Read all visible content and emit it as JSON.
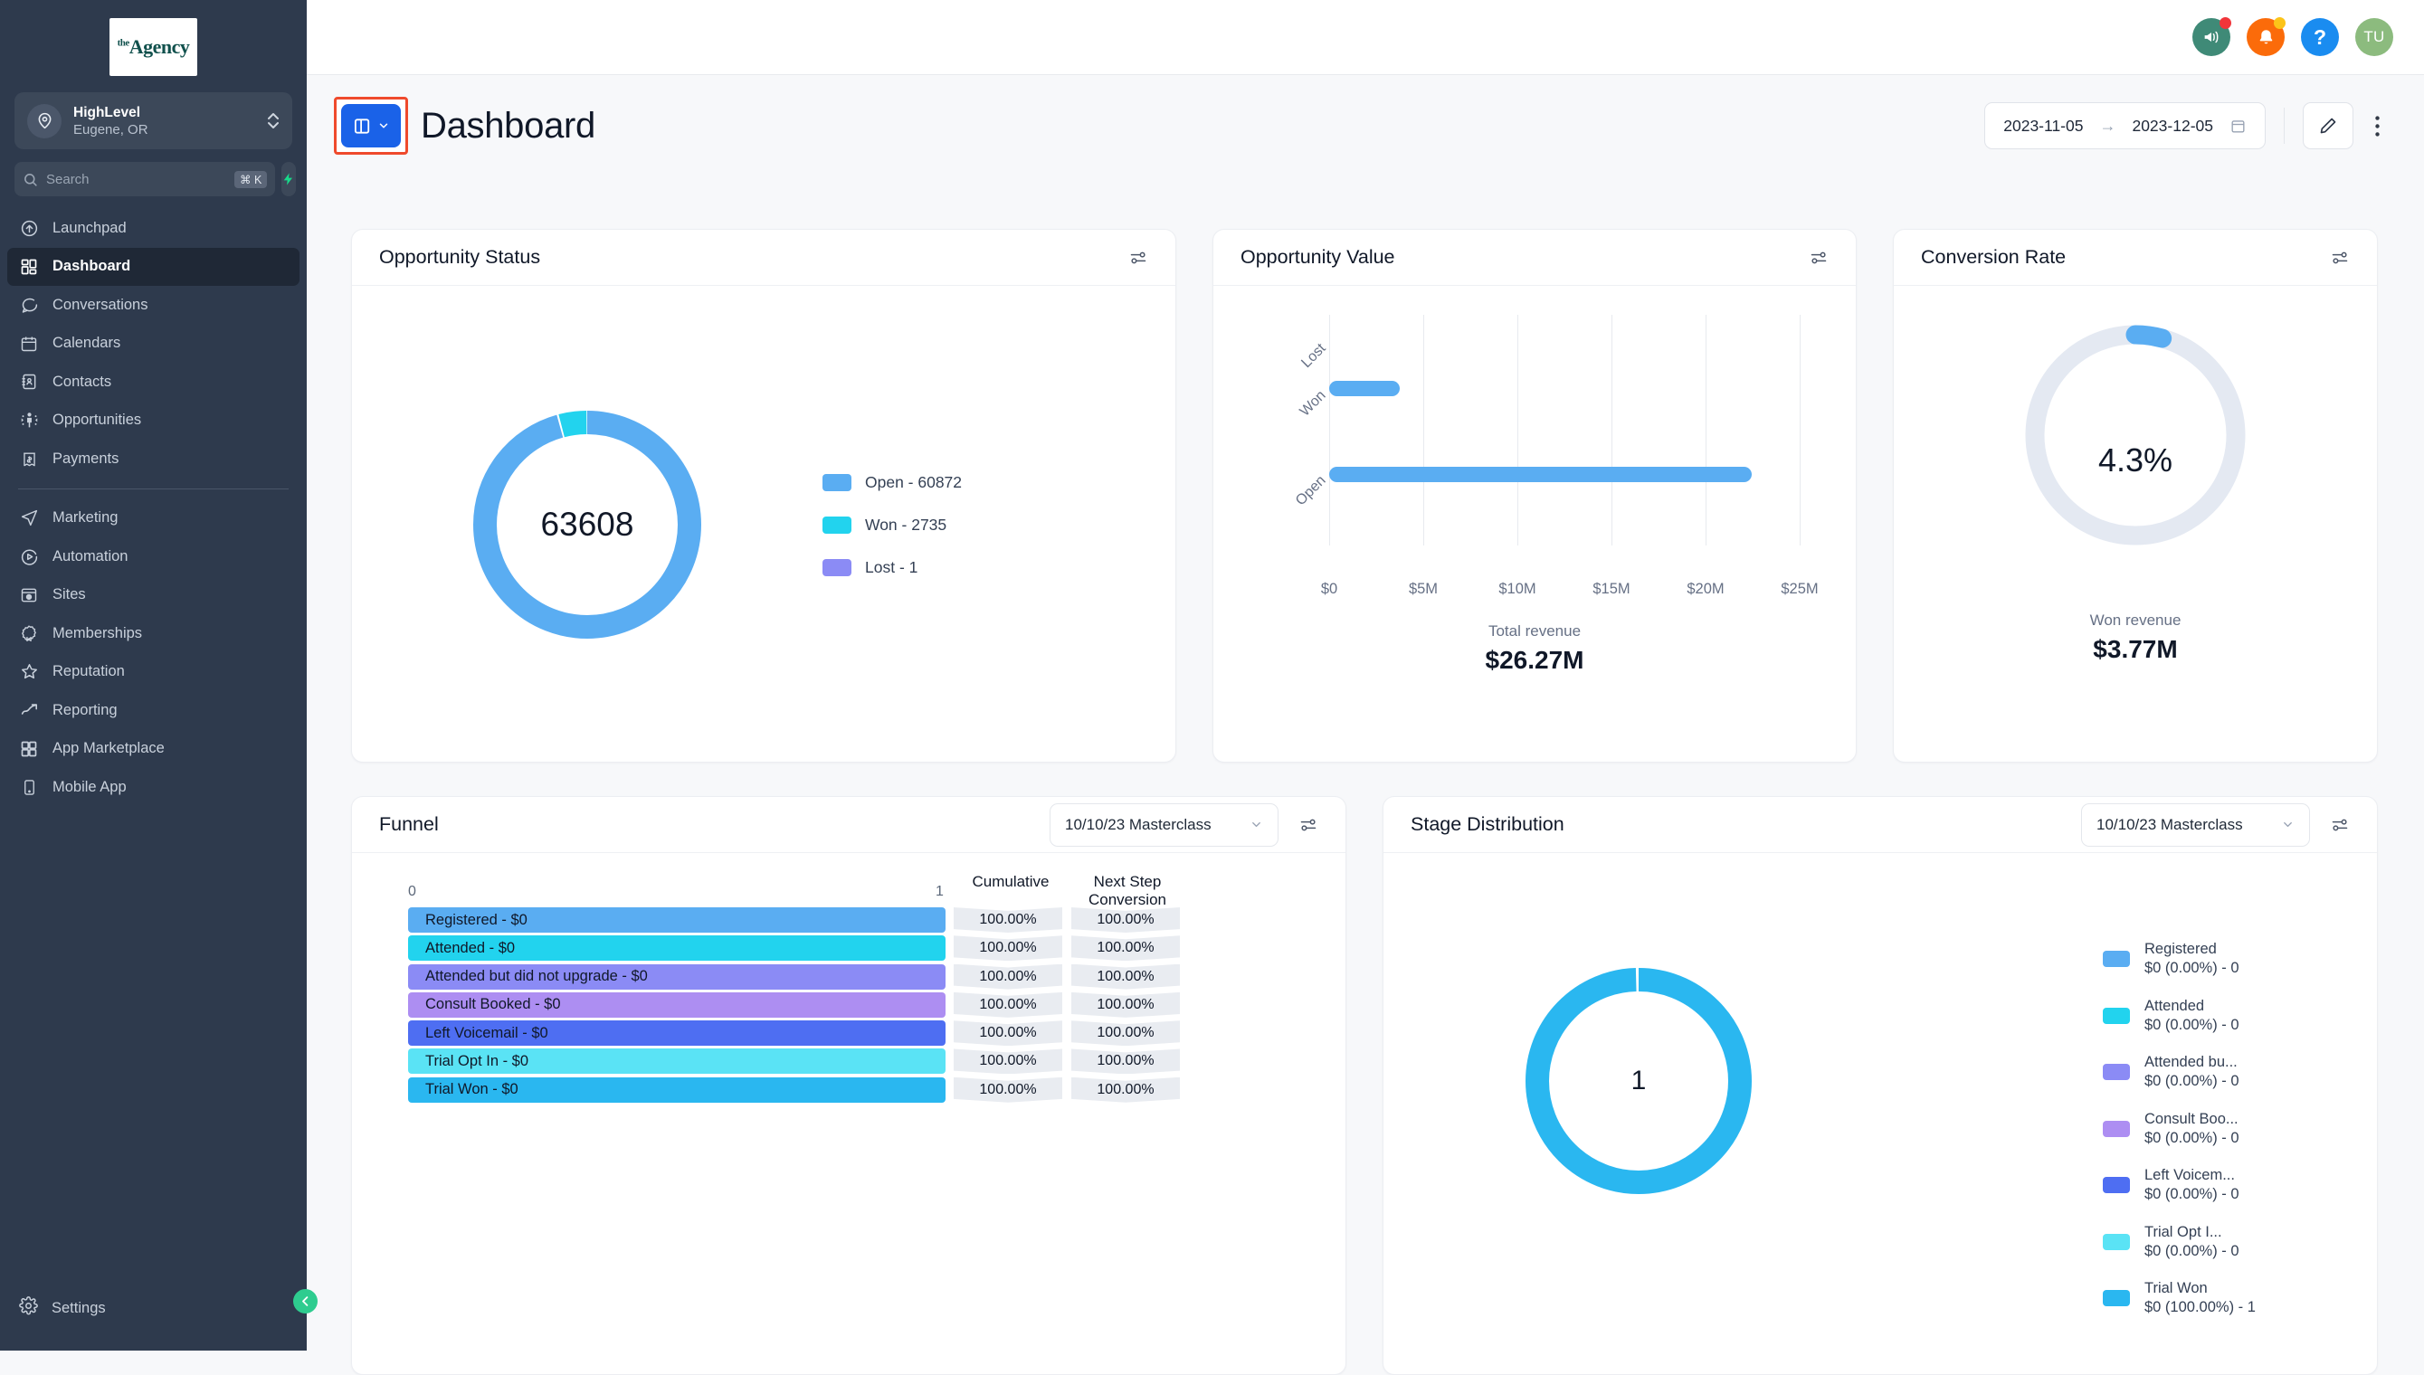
{
  "sidebar": {
    "logo": {
      "the": "the",
      "agency": "Agency"
    },
    "account": {
      "name": "HighLevel",
      "location": "Eugene, OR"
    },
    "search": {
      "placeholder": "Search",
      "value": "",
      "shortcut": "⌘ K"
    },
    "items": [
      {
        "label": "Launchpad",
        "icon": "rocket-up-icon",
        "active": false
      },
      {
        "label": "Dashboard",
        "icon": "grid-icon",
        "active": true
      },
      {
        "label": "Conversations",
        "icon": "chat-bubble-icon",
        "active": false
      },
      {
        "label": "Calendars",
        "icon": "calendar-icon",
        "active": false
      },
      {
        "label": "Contacts",
        "icon": "contact-book-icon",
        "active": false
      },
      {
        "label": "Opportunities",
        "icon": "network-person-icon",
        "active": false
      },
      {
        "label": "Payments",
        "icon": "receipt-dollar-icon",
        "active": false
      },
      {
        "label": "Marketing",
        "icon": "paper-plane-icon",
        "active": false
      },
      {
        "label": "Automation",
        "icon": "play-circle-icon",
        "active": false
      },
      {
        "label": "Sites",
        "icon": "browser-globe-icon",
        "active": false
      },
      {
        "label": "Memberships",
        "icon": "badge-icon",
        "active": false
      },
      {
        "label": "Reputation",
        "icon": "star-icon",
        "active": false
      },
      {
        "label": "Reporting",
        "icon": "trend-up-icon",
        "active": false
      },
      {
        "label": "App Marketplace",
        "icon": "grid-icon",
        "active": false
      },
      {
        "label": "Mobile App",
        "icon": "mobile-icon",
        "active": false
      }
    ],
    "settings_label": "Settings",
    "collapse_icon": "chevron-left-icon"
  },
  "topbar": {
    "icons": [
      {
        "name": "megaphone-icon",
        "color": "#3f8a77",
        "badge": "#f1353a"
      },
      {
        "name": "bell-icon",
        "color": "#fb6b0a",
        "badge": "#fcc419"
      },
      {
        "name": "help-icon",
        "color": "#1a8cf0",
        "badge": ""
      }
    ],
    "avatar_initials": "TU",
    "avatar_color": "#8cbb7e"
  },
  "header": {
    "title": "Dashboard",
    "dashboard_selector_icon": "layout-panel-icon",
    "date_start": "2023-11-05",
    "date_end": "2023-12-05",
    "date_arrow": "→",
    "calendar_icon": "calendar-icon",
    "edit_icon": "pencil-icon",
    "more_icon": "kebab-menu-icon",
    "highlight_color": "#ef4a2c",
    "accent_color": "#1a62e8"
  },
  "cards": {
    "opportunity_status": {
      "title": "Opportunity Status",
      "settings_icon": "sliders-icon",
      "center_value": "63608"
    },
    "opportunity_value": {
      "title": "Opportunity Value",
      "settings_icon": "sliders-icon",
      "total_label": "Total revenue",
      "total_value": "$26.27M"
    },
    "conversion_rate": {
      "title": "Conversion Rate",
      "settings_icon": "sliders-icon",
      "percent": "4.3%",
      "sub_label": "Won revenue",
      "sub_value": "$3.77M"
    },
    "funnel": {
      "title": "Funnel",
      "pipeline": "10/10/23 Masterclass",
      "settings_icon": "sliders-icon",
      "axis_min": "0",
      "axis_max": "1",
      "col_cumulative": "Cumulative",
      "col_next_step": "Next Step\nConversion"
    },
    "stage_distribution": {
      "title": "Stage Distribution",
      "pipeline": "10/10/23 Masterclass",
      "settings_icon": "sliders-icon",
      "center_value": "1"
    }
  },
  "chart_data": [
    {
      "type": "pie",
      "title": "Opportunity Status",
      "center_label": "63608",
      "legend_position": "right",
      "labels": [
        "Open",
        "Won",
        "Lost"
      ],
      "values": [
        60872,
        2735,
        1
      ],
      "colors": [
        "#5aadf2",
        "#22d3ee",
        "#8b8bf5"
      ],
      "legend_entries": [
        "Open - 60872",
        "Won - 2735",
        "Lost - 1"
      ]
    },
    {
      "type": "bar",
      "orientation": "horizontal",
      "title": "Opportunity Value",
      "categories": [
        "Lost",
        "Won",
        "Open"
      ],
      "values": [
        0,
        3.77,
        22.5
      ],
      "unit": "millions USD",
      "xlim": [
        0,
        27.5
      ],
      "xticks": [
        "$0",
        "$5M",
        "$10M",
        "$15M",
        "$20M",
        "$25M"
      ],
      "xtick_values": [
        0,
        5,
        10,
        15,
        20,
        25
      ],
      "grid": true,
      "color": "#5aadf2",
      "footer_label": "Total revenue",
      "footer_value": "$26.27M"
    },
    {
      "type": "pie",
      "title": "Conversion Rate",
      "center_label": "4.3%",
      "values": [
        4.3,
        95.7
      ],
      "colors": [
        "#5aadf2",
        "#e4e9f2"
      ],
      "footer_label": "Won revenue",
      "footer_value": "$3.77M"
    },
    {
      "type": "bar",
      "orientation": "funnel",
      "title": "Funnel",
      "axis_min": 0,
      "axis_max": 1,
      "stages": [
        {
          "label": "Registered - $0",
          "color": "#5aadf2",
          "width_pct": 100,
          "cumulative": "100.00%",
          "next_step": "100.00%"
        },
        {
          "label": "Attended - $0",
          "color": "#22d3ee",
          "width_pct": 100,
          "cumulative": "100.00%",
          "next_step": "100.00%"
        },
        {
          "label": "Attended but did not upgrade - $0",
          "color": "#8b8bf5",
          "width_pct": 100,
          "cumulative": "100.00%",
          "next_step": "100.00%"
        },
        {
          "label": "Consult Booked - $0",
          "color": "#ad8ef2",
          "width_pct": 100,
          "cumulative": "100.00%",
          "next_step": "100.00%"
        },
        {
          "label": "Left Voicemail - $0",
          "color": "#4e6ef2",
          "width_pct": 100,
          "cumulative": "100.00%",
          "next_step": "100.00%"
        },
        {
          "label": "Trial Opt In - $0",
          "color": "#5ae3f5",
          "width_pct": 100,
          "cumulative": "100.00%",
          "next_step": "100.00%"
        },
        {
          "label": "Trial Won - $0",
          "color": "#2ab7f0",
          "width_pct": 100,
          "cumulative": "100.00%",
          "next_step": "100.00%"
        }
      ]
    },
    {
      "type": "pie",
      "title": "Stage Distribution",
      "center_label": "1",
      "legend_position": "right",
      "labels": [
        "Registered",
        "Attended",
        "Attended bu...",
        "Consult Boo...",
        "Left Voicem...",
        "Trial Opt I...",
        "Trial Won"
      ],
      "sublabels": [
        "$0 (0.00%) - 0",
        "$0 (0.00%) - 0",
        "$0 (0.00%) - 0",
        "$0 (0.00%) - 0",
        "$0 (0.00%) - 0",
        "$0 (0.00%) - 0",
        "$0 (100.00%) - 1"
      ],
      "values": [
        0,
        0,
        0,
        0,
        0,
        0,
        1
      ],
      "colors": [
        "#5aadf2",
        "#22d3ee",
        "#8b8bf5",
        "#ad8ef2",
        "#4e6ef2",
        "#5ae3f5",
        "#2ab7f0"
      ]
    }
  ]
}
